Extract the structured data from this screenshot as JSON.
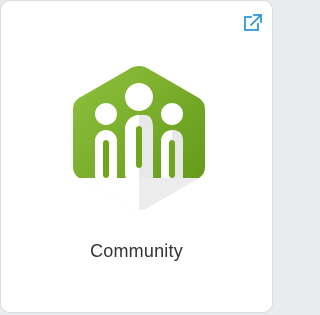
{
  "card": {
    "label": "Community",
    "external_link_icon": "external-link-icon",
    "logo_icon": "community-people-icon"
  },
  "colors": {
    "brand_green": "#6ea61c",
    "brand_green_light": "#8fc23d",
    "icon_blue": "#2a97d6",
    "text": "#333333"
  }
}
